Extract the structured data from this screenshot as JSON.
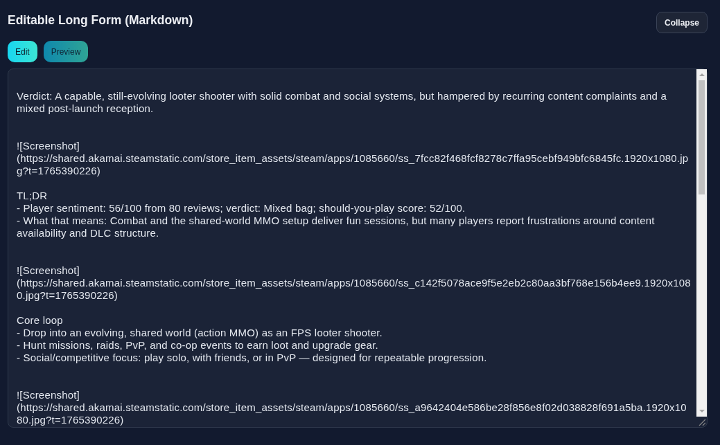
{
  "header": {
    "title": "Editable Long Form (Markdown)",
    "collapse_button": "Collapse"
  },
  "tabs": [
    {
      "label": "Edit",
      "selected": true
    },
    {
      "label": "Preview",
      "selected": false
    }
  ],
  "editor": {
    "value": "Verdict: A capable, still-evolving looter shooter with solid combat and social systems, but hampered by recurring content complaints and a mixed post-launch reception.\n\n\n![Screenshot](https://shared.akamai.steamstatic.com/store_item_assets/steam/apps/1085660/ss_7fcc82f468fcf8278c7ffa95cebf949bfc6845fc.1920x1080.jpg?t=1765390226)\n\nTL;DR\n- Player sentiment: 56/100 from 80 reviews; verdict: Mixed bag; should-you-play score: 52/100.\n- What that means: Combat and the shared-world MMO setup deliver fun sessions, but many players report frustrations around content availability and DLC structure.\n\n\n![Screenshot](https://shared.akamai.steamstatic.com/store_item_assets/steam/apps/1085660/ss_c142f5078ace9f5e2eb2c80aa3bf768e156b4ee9.1920x1080.jpg?t=1765390226)\n\nCore loop\n- Drop into an evolving, shared world (action MMO) as an FPS looter shooter.\n- Hunt missions, raids, PvP, and co-op events to earn loot and upgrade gear.\n- Social/competitive focus: play solo, with friends, or in PvP — designed for repeatable progression.\n\n\n![Screenshot](https://shared.akamai.steamstatic.com/store_item_assets/steam/apps/1085660/ss_a9642404e586be28f856e8f02d038828f691a5ba.1920x1080.jpg?t=1765390226)"
  }
}
